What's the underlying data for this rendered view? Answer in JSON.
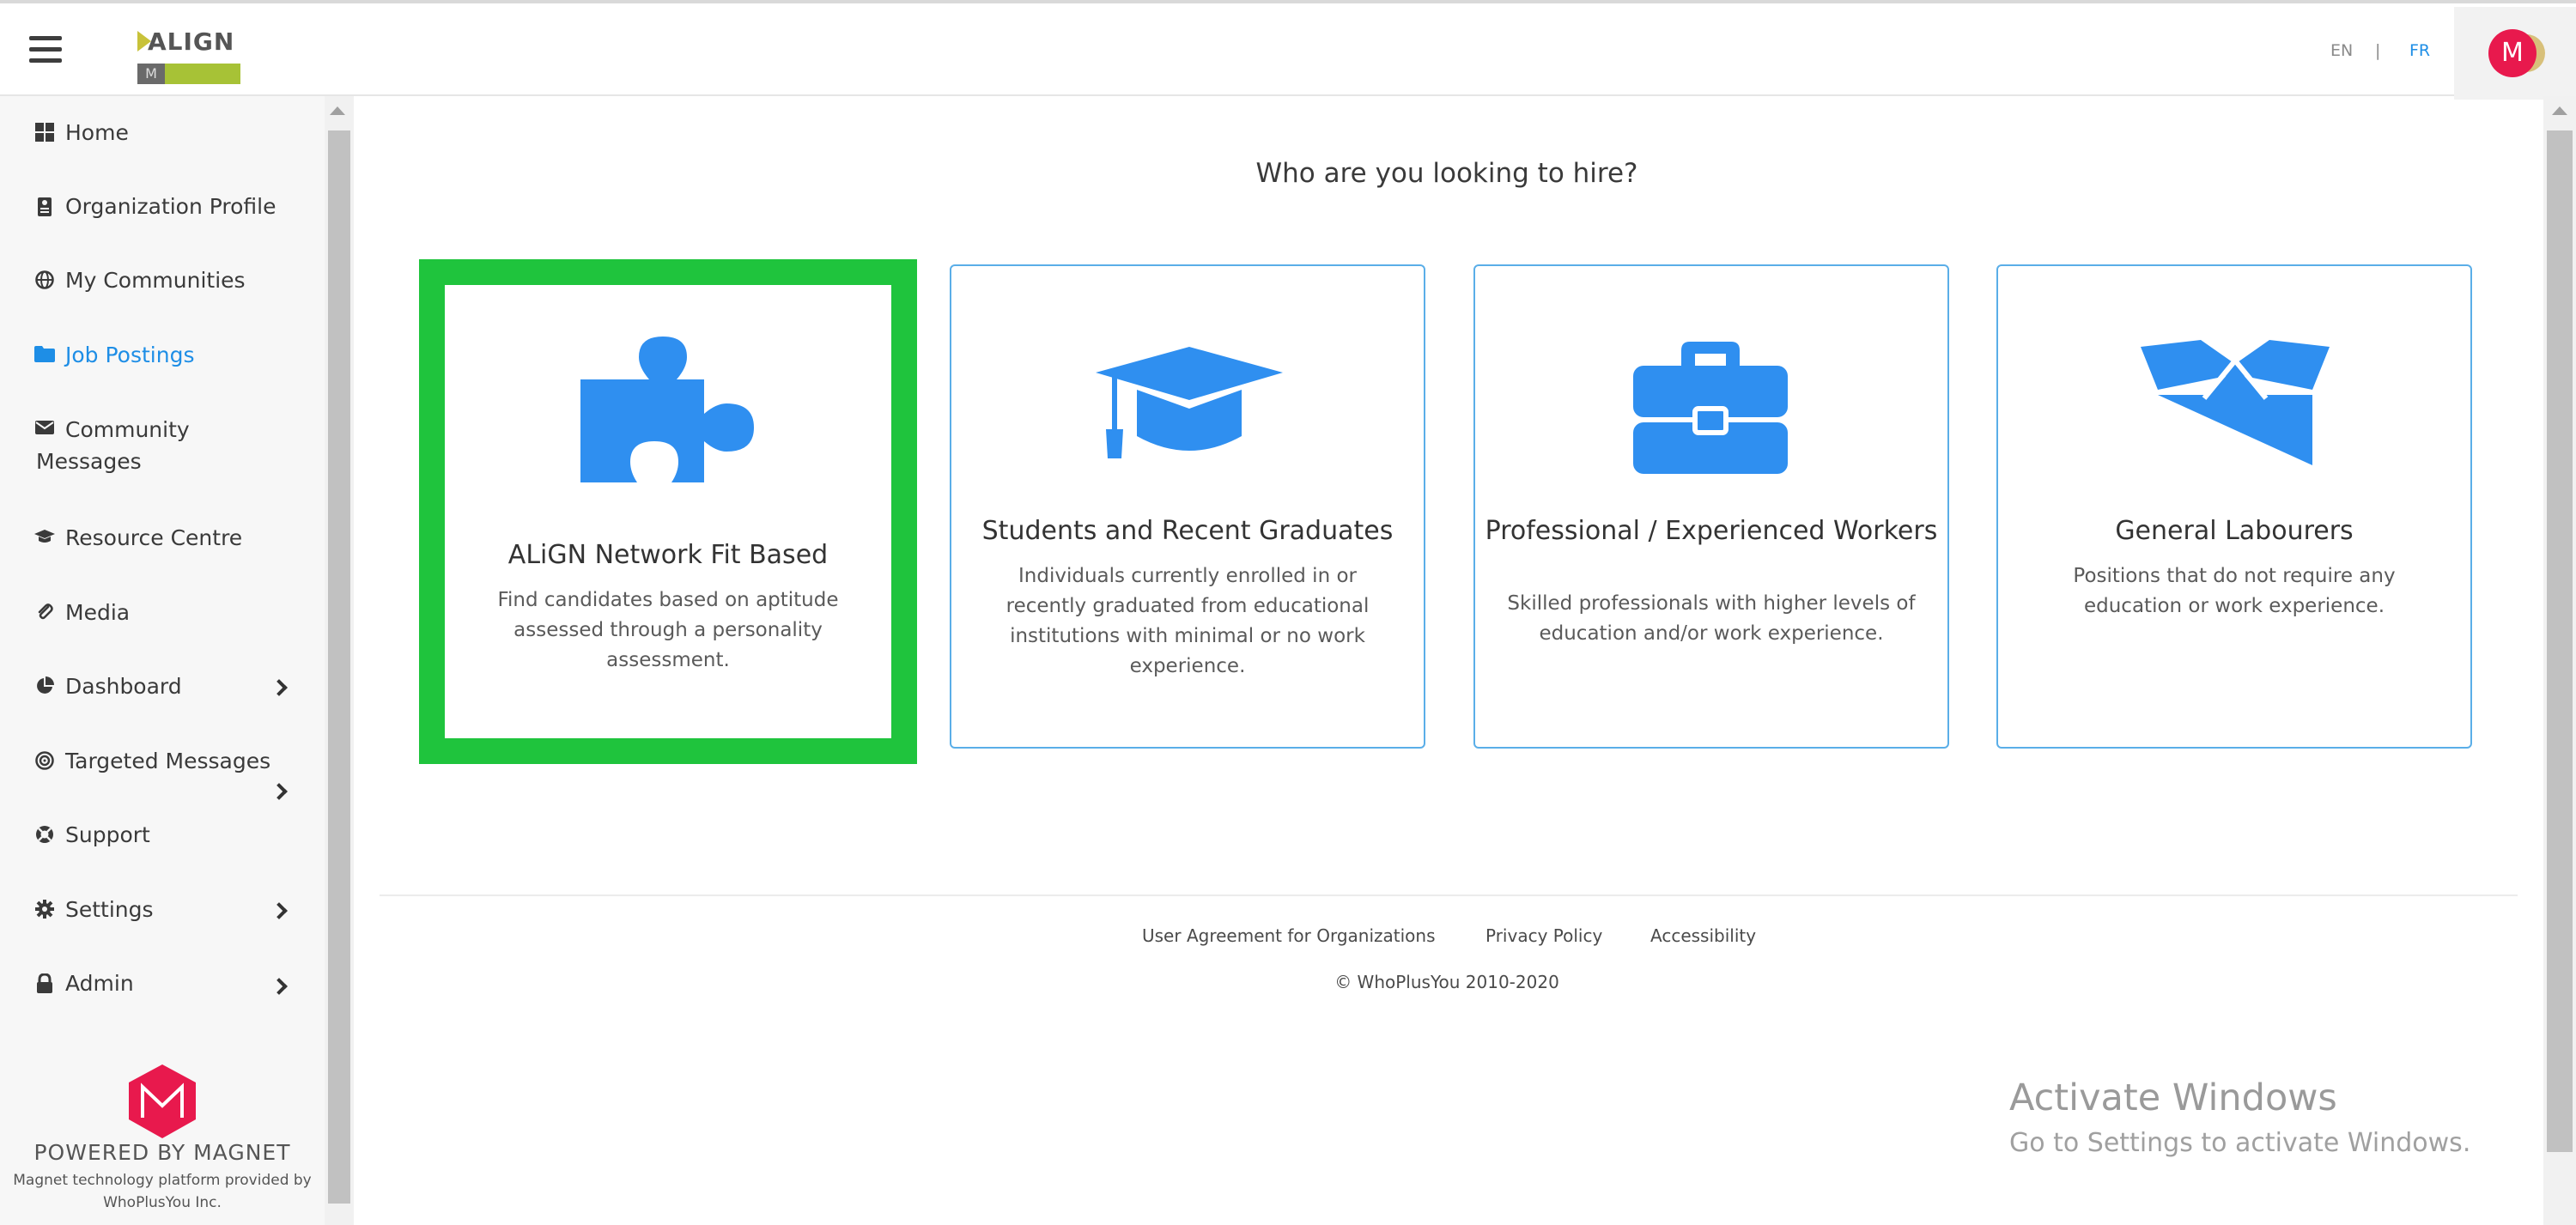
{
  "header": {
    "logo_text": "ALIGN",
    "lang_en": "EN",
    "lang_sep": "|",
    "lang_fr": "FR",
    "avatar_letter": "M"
  },
  "sidebar": {
    "items": [
      {
        "label": "Home",
        "icon": "grid-icon"
      },
      {
        "label": "Organization Profile",
        "icon": "id-card-icon"
      },
      {
        "label": "My Communities",
        "icon": "globe-icon"
      },
      {
        "label": "Job Postings",
        "icon": "folder-icon",
        "active": true
      },
      {
        "label": "Community",
        "label2": "Messages",
        "icon": "envelope-icon"
      },
      {
        "label": "Resource Centre",
        "icon": "graduation-cap-icon"
      },
      {
        "label": "Media",
        "icon": "paperclip-icon"
      },
      {
        "label": "Dashboard",
        "icon": "pie-chart-icon"
      },
      {
        "label": "Targeted Messages",
        "icon": "target-icon"
      },
      {
        "label": "Support",
        "icon": "life-ring-icon"
      },
      {
        "label": "Settings",
        "icon": "gear-icon"
      },
      {
        "label": "Admin",
        "icon": "lock-icon"
      }
    ],
    "powered_by": "POWERED BY MAGNET",
    "powered_note_1": "Magnet technology platform provided by",
    "powered_note_2": "WhoPlusYou Inc."
  },
  "main": {
    "question": "Who are you looking to hire?",
    "cards": [
      {
        "title": "ALiGN Network Fit Based",
        "description": "Find candidates based on aptitude assessed through a personality assessment.",
        "icon": "puzzle-icon",
        "selected": true
      },
      {
        "title": "Students and Recent Graduates",
        "description": "Individuals currently enrolled in or recently graduated from educational institutions with minimal or no work experience.",
        "icon": "graduation-cap-icon"
      },
      {
        "title": "Professional / Experienced Workers",
        "description": "Skilled professionals with higher levels of education and/or work experience.",
        "icon": "briefcase-icon"
      },
      {
        "title": "General Labourers",
        "description": "Positions that do not require any education or work experience.",
        "icon": "open-box-icon"
      }
    ]
  },
  "footer": {
    "link_user_agreement": "User Agreement for Organizations",
    "link_privacy": "Privacy Policy",
    "link_accessibility": "Accessibility",
    "copyright": "© WhoPlusYou 2010-2020"
  },
  "watermark": {
    "line1": "Activate Windows",
    "line2": "Go to Settings to activate Windows."
  },
  "colors": {
    "accent_blue": "#1e8ee6",
    "icon_blue": "#2f8ff0",
    "selected_green": "#1fc43d",
    "magnet_red": "#e8194d"
  }
}
